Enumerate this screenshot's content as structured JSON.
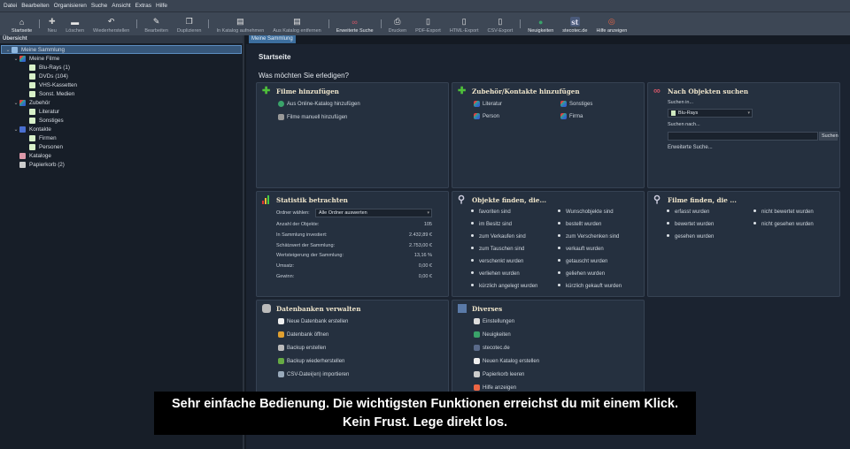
{
  "menu": [
    "Datei",
    "Bearbeiten",
    "Organisieren",
    "Suche",
    "Ansicht",
    "Extras",
    "Hilfe"
  ],
  "toolbar": [
    {
      "label": "Startseite",
      "icon": "home-icon",
      "glyph": "⌂"
    },
    {
      "label": "Neu",
      "icon": "plus-icon",
      "glyph": "✚"
    },
    {
      "label": "Löschen",
      "icon": "minus-icon",
      "glyph": "▬"
    },
    {
      "label": "Wiederherstellen",
      "icon": "undo-icon",
      "glyph": "↶"
    },
    {
      "label": "Bearbeiten",
      "icon": "edit-icon",
      "glyph": "✎"
    },
    {
      "label": "Duplizieren",
      "icon": "duplicate-icon",
      "glyph": "❐"
    },
    {
      "label": "In Katalog aufnehmen",
      "icon": "catalog-add-icon",
      "glyph": "▤"
    },
    {
      "label": "Aus Katalog entfernen",
      "icon": "catalog-remove-icon",
      "glyph": "▤"
    },
    {
      "label": "Erweiterte Suche",
      "icon": "binoculars-icon",
      "glyph": "∞"
    },
    {
      "label": "Drucken",
      "icon": "printer-icon",
      "glyph": "⎙"
    },
    {
      "label": "PDF-Export",
      "icon": "pdf-icon",
      "glyph": "▯"
    },
    {
      "label": "HTML-Export",
      "icon": "html-export-icon",
      "glyph": "▯"
    },
    {
      "label": "CSV-Export",
      "icon": "csv-export-icon",
      "glyph": "▯"
    },
    {
      "label": "Neuigkeiten",
      "icon": "globe-icon",
      "glyph": "●"
    },
    {
      "label": "stecotec.de",
      "icon": "stecotec-logo-icon",
      "glyph": "st"
    },
    {
      "label": "Hilfe anzeigen",
      "icon": "lifebuoy-icon",
      "glyph": "◎"
    }
  ],
  "sidebar": {
    "header": "Übersicht",
    "tree": [
      {
        "label": "Meine Sammlung",
        "level": 0,
        "chev": true
      },
      {
        "label": "Meine Filme",
        "level": 1,
        "chev": true
      },
      {
        "label": "Blu-Rays (1)",
        "level": 2
      },
      {
        "label": "DVDs (104)",
        "level": 2
      },
      {
        "label": "VHS-Kassetten",
        "level": 2
      },
      {
        "label": "Sonst. Medien",
        "level": 2
      },
      {
        "label": "Zubehör",
        "level": 1,
        "chev": true
      },
      {
        "label": "Literatur",
        "level": 2
      },
      {
        "label": "Sonstiges",
        "level": 2
      },
      {
        "label": "Kontakte",
        "level": 1,
        "chev": true
      },
      {
        "label": "Firmen",
        "level": 2
      },
      {
        "label": "Personen",
        "level": 2
      },
      {
        "label": "Kataloge",
        "level": 1
      },
      {
        "label": "Papierkorb (2)",
        "level": 1
      }
    ]
  },
  "tab": "Meine Sammlung",
  "main": {
    "title": "Startseite",
    "subtitle": "Was möchten Sie erledigen?"
  },
  "cards": {
    "filme": {
      "title": "Filme hinzufügen",
      "links": [
        "Aus Online-Katalog hinzufügen",
        "Filme manuell hinzufügen"
      ]
    },
    "zubehoer": {
      "title": "Zubehör/Kontakte hinzufügen",
      "links": [
        "Literatur",
        "Sonstiges",
        "Person",
        "Firma"
      ]
    },
    "suche": {
      "title": "Nach Objekten suchen",
      "in_label": "Suchen in...",
      "in_value": "Blu-Rays",
      "nach_label": "Suchen nach...",
      "nach_value": "",
      "button": "Suchen",
      "advanced": "Erweiterte Suche..."
    },
    "statistik": {
      "title": "Statistik betrachten",
      "folder_label": "Ordner wählen:",
      "folder_value": "Alle Ordner auswerten",
      "rows": [
        {
          "label": "Anzahl der Objekte:",
          "value": "105"
        },
        {
          "label": "In Sammlung investiert:",
          "value": "2.432,89 €"
        },
        {
          "label": "Schätzwert der Sammlung:",
          "value": "2.753,00 €"
        },
        {
          "label": "Wertsteigerung der Sammlung:",
          "value": "13,16 %"
        },
        {
          "label": "Umsatz:",
          "value": "0,00 €"
        },
        {
          "label": "Gewinn:",
          "value": "0,00 €"
        }
      ]
    },
    "objekte": {
      "title": "Objekte finden, die...",
      "left": [
        "favoriten sind",
        "im Besitz sind",
        "zum Verkaufen sind",
        "zum Tauschen sind",
        "verschenkt wurden",
        "verliehen wurden",
        "kürzlich angelegt wurden"
      ],
      "right": [
        "Wunschobjekte sind",
        "bestellt wurden",
        "zum Verschenken sind",
        "verkauft wurden",
        "getauscht wurden",
        "geliehen wurden",
        "kürzlich gekauft wurden"
      ]
    },
    "filmefinden": {
      "title": "Filme finden, die ...",
      "left": [
        "erfasst wurden",
        "bewertet wurden",
        "gesehen wurden"
      ],
      "right": [
        "nicht bewertet wurden",
        "nicht gesehen wurden"
      ]
    },
    "datenbanken": {
      "title": "Datenbanken verwalten",
      "links": [
        "Neue Datenbank erstellen",
        "Datenbank öffnen",
        "Backup erstellen",
        "Backup wiederherstellen",
        "CSV-Datei(en) importieren"
      ]
    },
    "diverses": {
      "title": "Diverses",
      "links": [
        "Einstellungen",
        "Neuigkeiten",
        "stecotec.de",
        "Neuen Katalog erstellen",
        "Papierkorb leeren",
        "Hilfe anzeigen"
      ]
    }
  },
  "caption": {
    "line1": "Sehr einfache Bedienung. Die wichtigsten Funktionen erreichst du mit einem Klick.",
    "line2": "Kein Frust. Lege direkt los."
  }
}
